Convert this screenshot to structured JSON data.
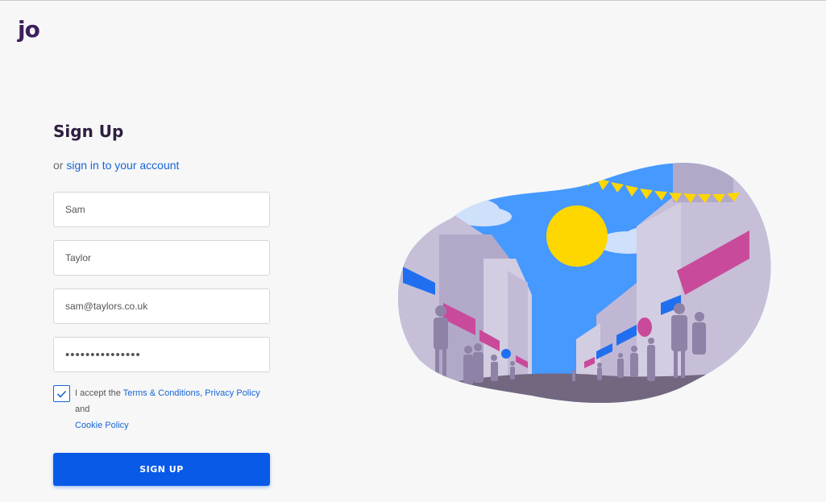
{
  "brand": {
    "logo_text": "jo"
  },
  "form": {
    "title": "Sign Up",
    "subtitle_prefix": "or",
    "signin_link": "sign in to your account",
    "first_name": "Sam",
    "last_name": "Taylor",
    "email": "sam@taylors.co.uk",
    "password": "•••••••••••••••",
    "terms_checked": true,
    "terms_prefix": "I accept the",
    "terms_link": "Terms & Conditions,",
    "privacy_link": "Privacy Policy",
    "terms_and": "and",
    "cookie_link": "Cookie Policy",
    "submit_label": "SIGN UP"
  },
  "colors": {
    "brand": "#3d1f5c",
    "accent": "#0a5ae8",
    "link": "#1665d8"
  },
  "icons": {
    "checkbox": "checkmark-icon",
    "illustration": "street-scene-illustration"
  }
}
